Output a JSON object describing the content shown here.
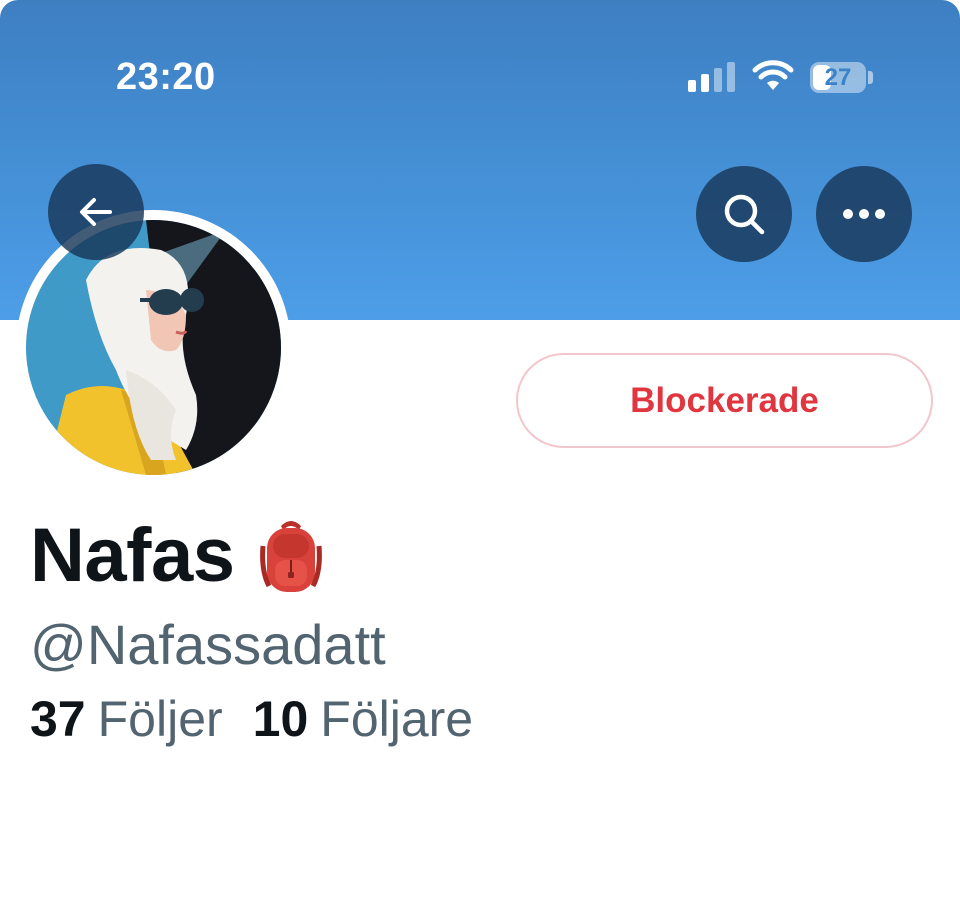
{
  "status_bar": {
    "time": "23:20",
    "battery_level": "27",
    "signal_bars_active": 2,
    "signal_bars_total": 4
  },
  "header": {
    "back_icon": "arrow-left-icon",
    "search_icon": "search-icon",
    "more_icon": "more-horizontal-icon",
    "banner_color": "#4590d6"
  },
  "profile": {
    "avatar_description_icon": "avatar-illustration",
    "blocked_button_label": "Blockerade",
    "blocked_color": "#e0363f",
    "display_name": "Nafas",
    "name_emoji_icon": "backpack-icon",
    "handle": "@Nafassadatt",
    "following_count": "37",
    "following_label": "Följer",
    "followers_count": "10",
    "followers_label": "Följare"
  }
}
